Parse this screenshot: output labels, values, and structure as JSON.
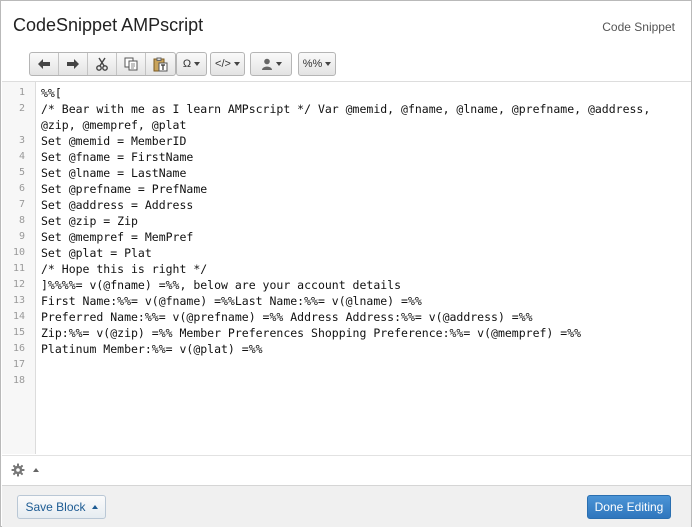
{
  "header": {
    "title": "CodeSnippet AMPscript",
    "subtitle": "Code Snippet"
  },
  "toolbar": {
    "buttons": [
      {
        "icon": "undo-icon"
      },
      {
        "icon": "redo-icon"
      },
      {
        "icon": "cut-icon"
      },
      {
        "icon": "copy-icon"
      },
      {
        "icon": "paste-text-icon"
      }
    ],
    "special_chars_label": "Ω",
    "code_label": "</>",
    "person_icon": "person-icon",
    "merge_label": "%%"
  },
  "editor": {
    "line_numbers": [
      "1",
      "2",
      "",
      "3",
      "4",
      "5",
      "6",
      "7",
      "8",
      "9",
      "10",
      "11",
      "12",
      "13",
      "14",
      "15",
      "16",
      "17",
      "18"
    ],
    "lines": [
      "%%[",
      "/* Bear with me as I learn AMPscript */ Var @memid, @fname, @lname, @prefname, @address,",
      "@zip, @mempref, @plat",
      "Set @memid = MemberID",
      "Set @fname = FirstName",
      "Set @lname = LastName",
      "Set @prefname = PrefName",
      "Set @address = Address",
      "Set @zip = Zip",
      "Set @mempref = MemPref",
      "Set @plat = Plat",
      "/* Hope this is right */",
      "]%%%%= v(@fname) =%%, below are your account details",
      "First Name:%%= v(@fname) =%%Last Name:%%= v(@lname) =%%",
      "Preferred Name:%%= v(@prefname) =%% Address Address:%%= v(@address) =%%",
      "Zip:%%= v(@zip) =%% Member Preferences Shopping Preference:%%= v(@mempref) =%%",
      "Platinum Member:%%= v(@plat) =%%",
      "",
      ""
    ]
  },
  "statusbar": {
    "settings_icon": "gear-icon"
  },
  "footer": {
    "save_label": "Save Block",
    "done_label": "Done Editing"
  },
  "colors": {
    "primary_button": "#2f76bd",
    "link_text": "#1d5b93"
  }
}
